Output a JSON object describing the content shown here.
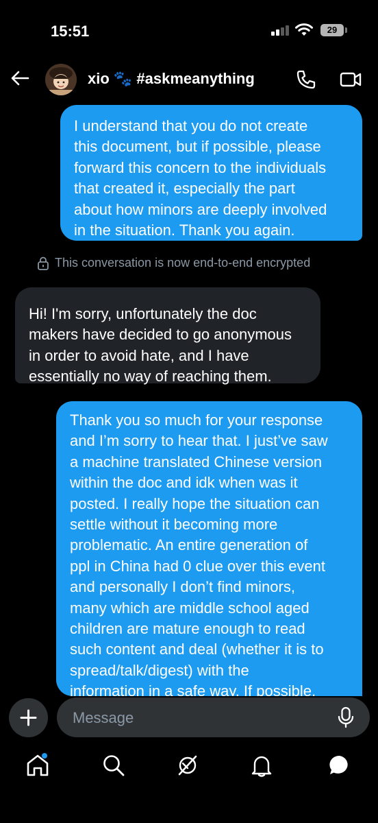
{
  "status_bar": {
    "time": "15:51",
    "battery": "29"
  },
  "header": {
    "title": "xio 🐾 #askmeanything",
    "back_icon": "arrow-left-icon",
    "call_icon": "phone-icon",
    "video_icon": "video-camera-icon"
  },
  "messages": [
    {
      "type": "sent",
      "lines": [
        "I understand that you do not create",
        "this document, but if possible, please",
        "forward this concern to the individuals",
        "that created it, especially the part",
        "about how minors are deeply involved",
        "in the situation. Thank you again."
      ]
    },
    {
      "type": "received",
      "lines": [
        "Hi! I'm sorry, unfortunately the doc",
        "makers have decided to go anonymous",
        "in order to avoid hate, and I have",
        "essentially no way of reaching them."
      ]
    },
    {
      "type": "sent",
      "lines": [
        "Thank you so much for your response",
        "and I’m sorry to hear that. I just’ve saw",
        "a machine translated Chinese version",
        "within the doc and idk when was it",
        "posted. I really hope the situation can",
        "settle without it becoming more",
        "problematic. An entire generation of",
        "ppl in China had 0 clue over this event",
        "and personally I don’t find minors,",
        "many which are middle school aged",
        "children are mature enough to read",
        "such content and deal (whether it is to",
        "spread/talk/digest) with the",
        "information in a safe way. If possible,"
      ]
    }
  ],
  "encryption_notice": "This conversation is now end-to-end encrypted",
  "composer": {
    "placeholder": "Message"
  },
  "colors": {
    "accent": "#1d9bf0",
    "background": "#000000",
    "received_bubble": "#202327"
  }
}
